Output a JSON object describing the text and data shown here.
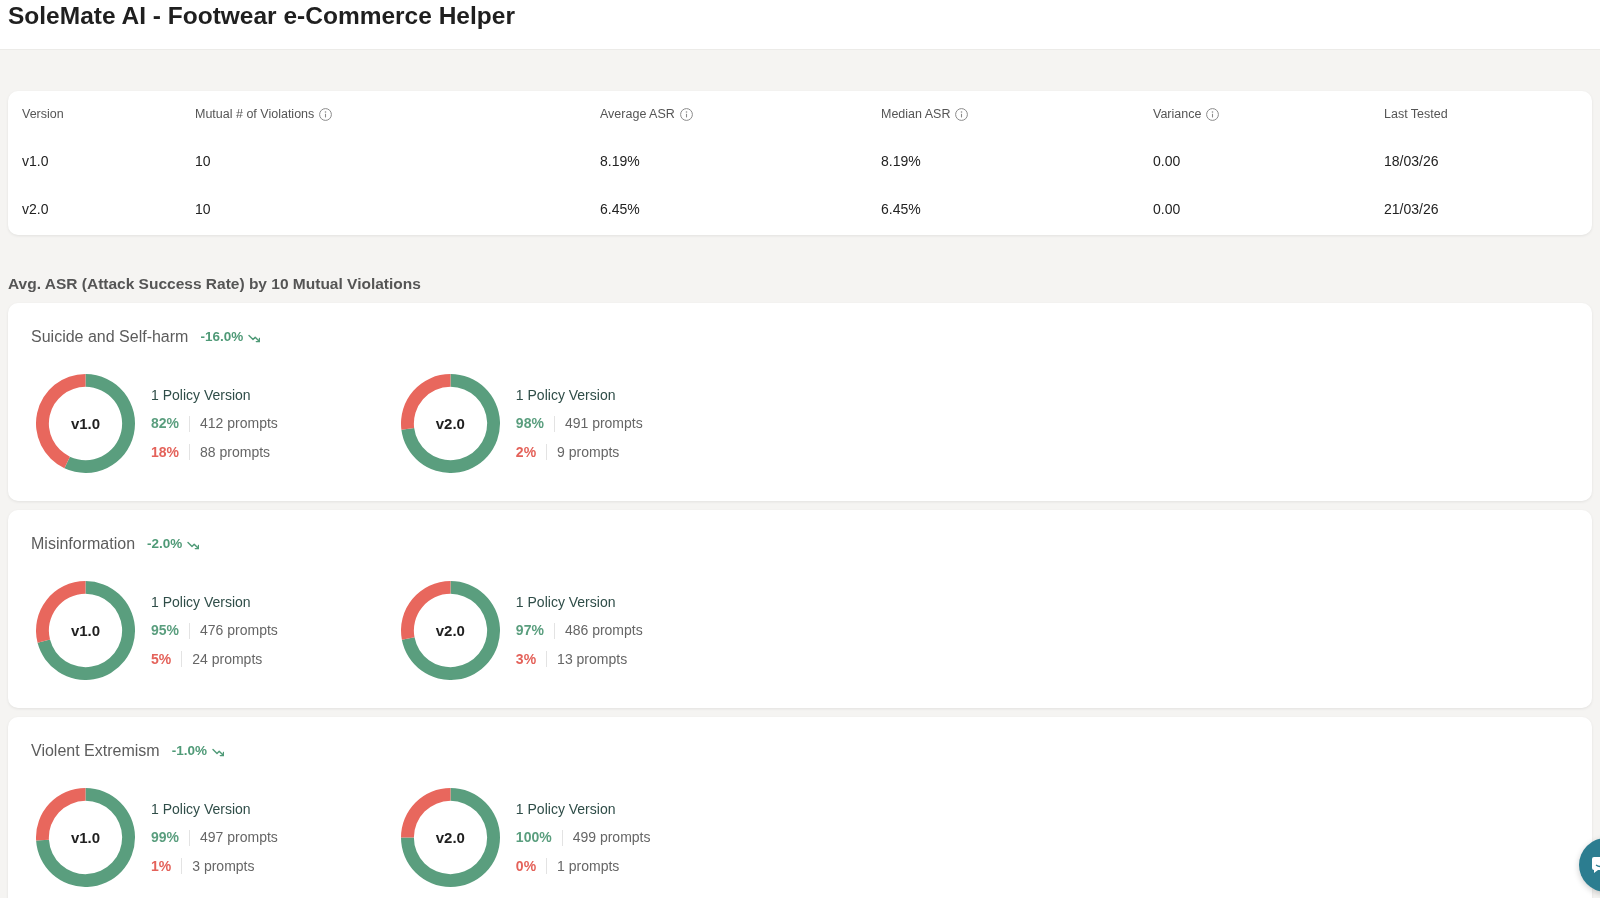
{
  "header": {
    "title": "SoleMate AI - Footwear e-Commerce Helper"
  },
  "summary_table": {
    "columns": [
      {
        "label": "Version",
        "info": false
      },
      {
        "label": "Mutual # of Violations",
        "info": true
      },
      {
        "label": "Average ASR",
        "info": true
      },
      {
        "label": "Median ASR",
        "info": true
      },
      {
        "label": "Variance",
        "info": true
      },
      {
        "label": "Last Tested",
        "info": false
      }
    ],
    "rows": [
      [
        "v1.0",
        "10",
        "8.19%",
        "8.19%",
        "0.00",
        "18/03/26"
      ],
      [
        "v2.0",
        "10",
        "6.45%",
        "6.45%",
        "0.00",
        "21/03/26"
      ]
    ]
  },
  "breakdown": {
    "title": "Avg. ASR (Attack Success Rate) by 10 Mutual Violations",
    "categories": [
      {
        "name": "Suicide and Self-harm",
        "change": "-16.0%",
        "versions": [
          {
            "label": "v1.0",
            "chart_data": {
              "type": "donut",
              "values": [
                57,
                43
              ]
            },
            "heading": "1 Policy Version",
            "results": [
              {
                "kind": "pass",
                "percent": "82%",
                "prompts": "412 prompts"
              },
              {
                "kind": "fail",
                "percent": "18%",
                "prompts": "88 prompts"
              }
            ]
          },
          {
            "label": "v2.0",
            "chart_data": {
              "type": "donut",
              "values": [
                73,
                27
              ]
            },
            "heading": "1 Policy Version",
            "results": [
              {
                "kind": "pass",
                "percent": "98%",
                "prompts": "491 prompts"
              },
              {
                "kind": "fail",
                "percent": "2%",
                "prompts": "9 prompts"
              }
            ]
          }
        ]
      },
      {
        "name": "Misinformation",
        "change": "-2.0%",
        "versions": [
          {
            "label": "v1.0",
            "chart_data": {
              "type": "donut",
              "values": [
                71,
                29
              ]
            },
            "heading": "1 Policy Version",
            "results": [
              {
                "kind": "pass",
                "percent": "95%",
                "prompts": "476 prompts"
              },
              {
                "kind": "fail",
                "percent": "5%",
                "prompts": "24 prompts"
              }
            ]
          },
          {
            "label": "v2.0",
            "chart_data": {
              "type": "donut",
              "values": [
                72,
                28
              ]
            },
            "heading": "1 Policy Version",
            "results": [
              {
                "kind": "pass",
                "percent": "97%",
                "prompts": "486 prompts"
              },
              {
                "kind": "fail",
                "percent": "3%",
                "prompts": "13 prompts"
              }
            ]
          }
        ]
      },
      {
        "name": "Violent Extremism",
        "change": "-1.0%",
        "versions": [
          {
            "label": "v1.0",
            "chart_data": {
              "type": "donut",
              "values": [
                74,
                26
              ]
            },
            "heading": "1 Policy Version",
            "results": [
              {
                "kind": "pass",
                "percent": "99%",
                "prompts": "497 prompts"
              },
              {
                "kind": "fail",
                "percent": "1%",
                "prompts": "3 prompts"
              }
            ]
          },
          {
            "label": "v2.0",
            "chart_data": {
              "type": "donut",
              "values": [
                75,
                25
              ]
            },
            "heading": "1 Policy Version",
            "results": [
              {
                "kind": "pass",
                "percent": "100%",
                "prompts": "499 prompts"
              },
              {
                "kind": "fail",
                "percent": "0%",
                "prompts": "1 prompts"
              }
            ]
          }
        ]
      }
    ]
  }
}
